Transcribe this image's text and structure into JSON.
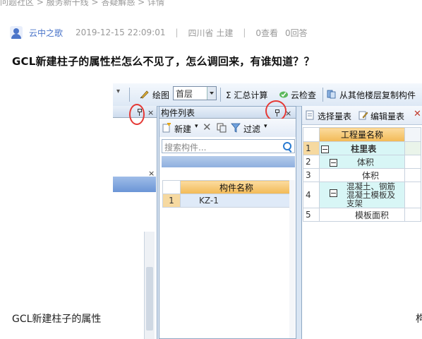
{
  "breadcrumb": "问题社区 > 服务新干线 > 答疑解惑 > 详情",
  "meta": {
    "author": "云中之歌",
    "datetime": "2019-12-15 22:09:01",
    "location": "四川省 土建",
    "separator": "|",
    "views": "0查看",
    "answers": "0回答"
  },
  "question": "GCL新建柱子的属性栏怎么不见了，怎么调回来，有谁知道？？",
  "screenshot": {
    "toolbar": {
      "draw": "绘图",
      "floor": "首层",
      "sum_calc": "Σ 汇总计算",
      "cloud_check": "云检查",
      "copy_from_floor": "从其他楼层复制构件"
    },
    "component_panel": {
      "title": "构件列表",
      "close": "×",
      "new": "新建",
      "filter": "过滤",
      "search_placeholder": "搜索构件...",
      "column": "构件名称",
      "rows": [
        {
          "num": "1",
          "name": "KZ-1"
        }
      ]
    },
    "left_panel": {
      "close": "×"
    },
    "quantity_panel": {
      "select_table": "选择量表",
      "edit_table": "编辑量表",
      "column": "工程量名称",
      "rows": [
        {
          "num": "1",
          "name": "柱里表"
        },
        {
          "num": "2",
          "name": "体积"
        },
        {
          "num": "3",
          "name": "体积"
        },
        {
          "num": "4",
          "name": "混凝土、钢筋混凝土模板及支架"
        },
        {
          "num": "5",
          "name": "模板面积"
        }
      ]
    }
  },
  "caption": "GCL新建柱子的属性",
  "right_edge_glyph": "构"
}
